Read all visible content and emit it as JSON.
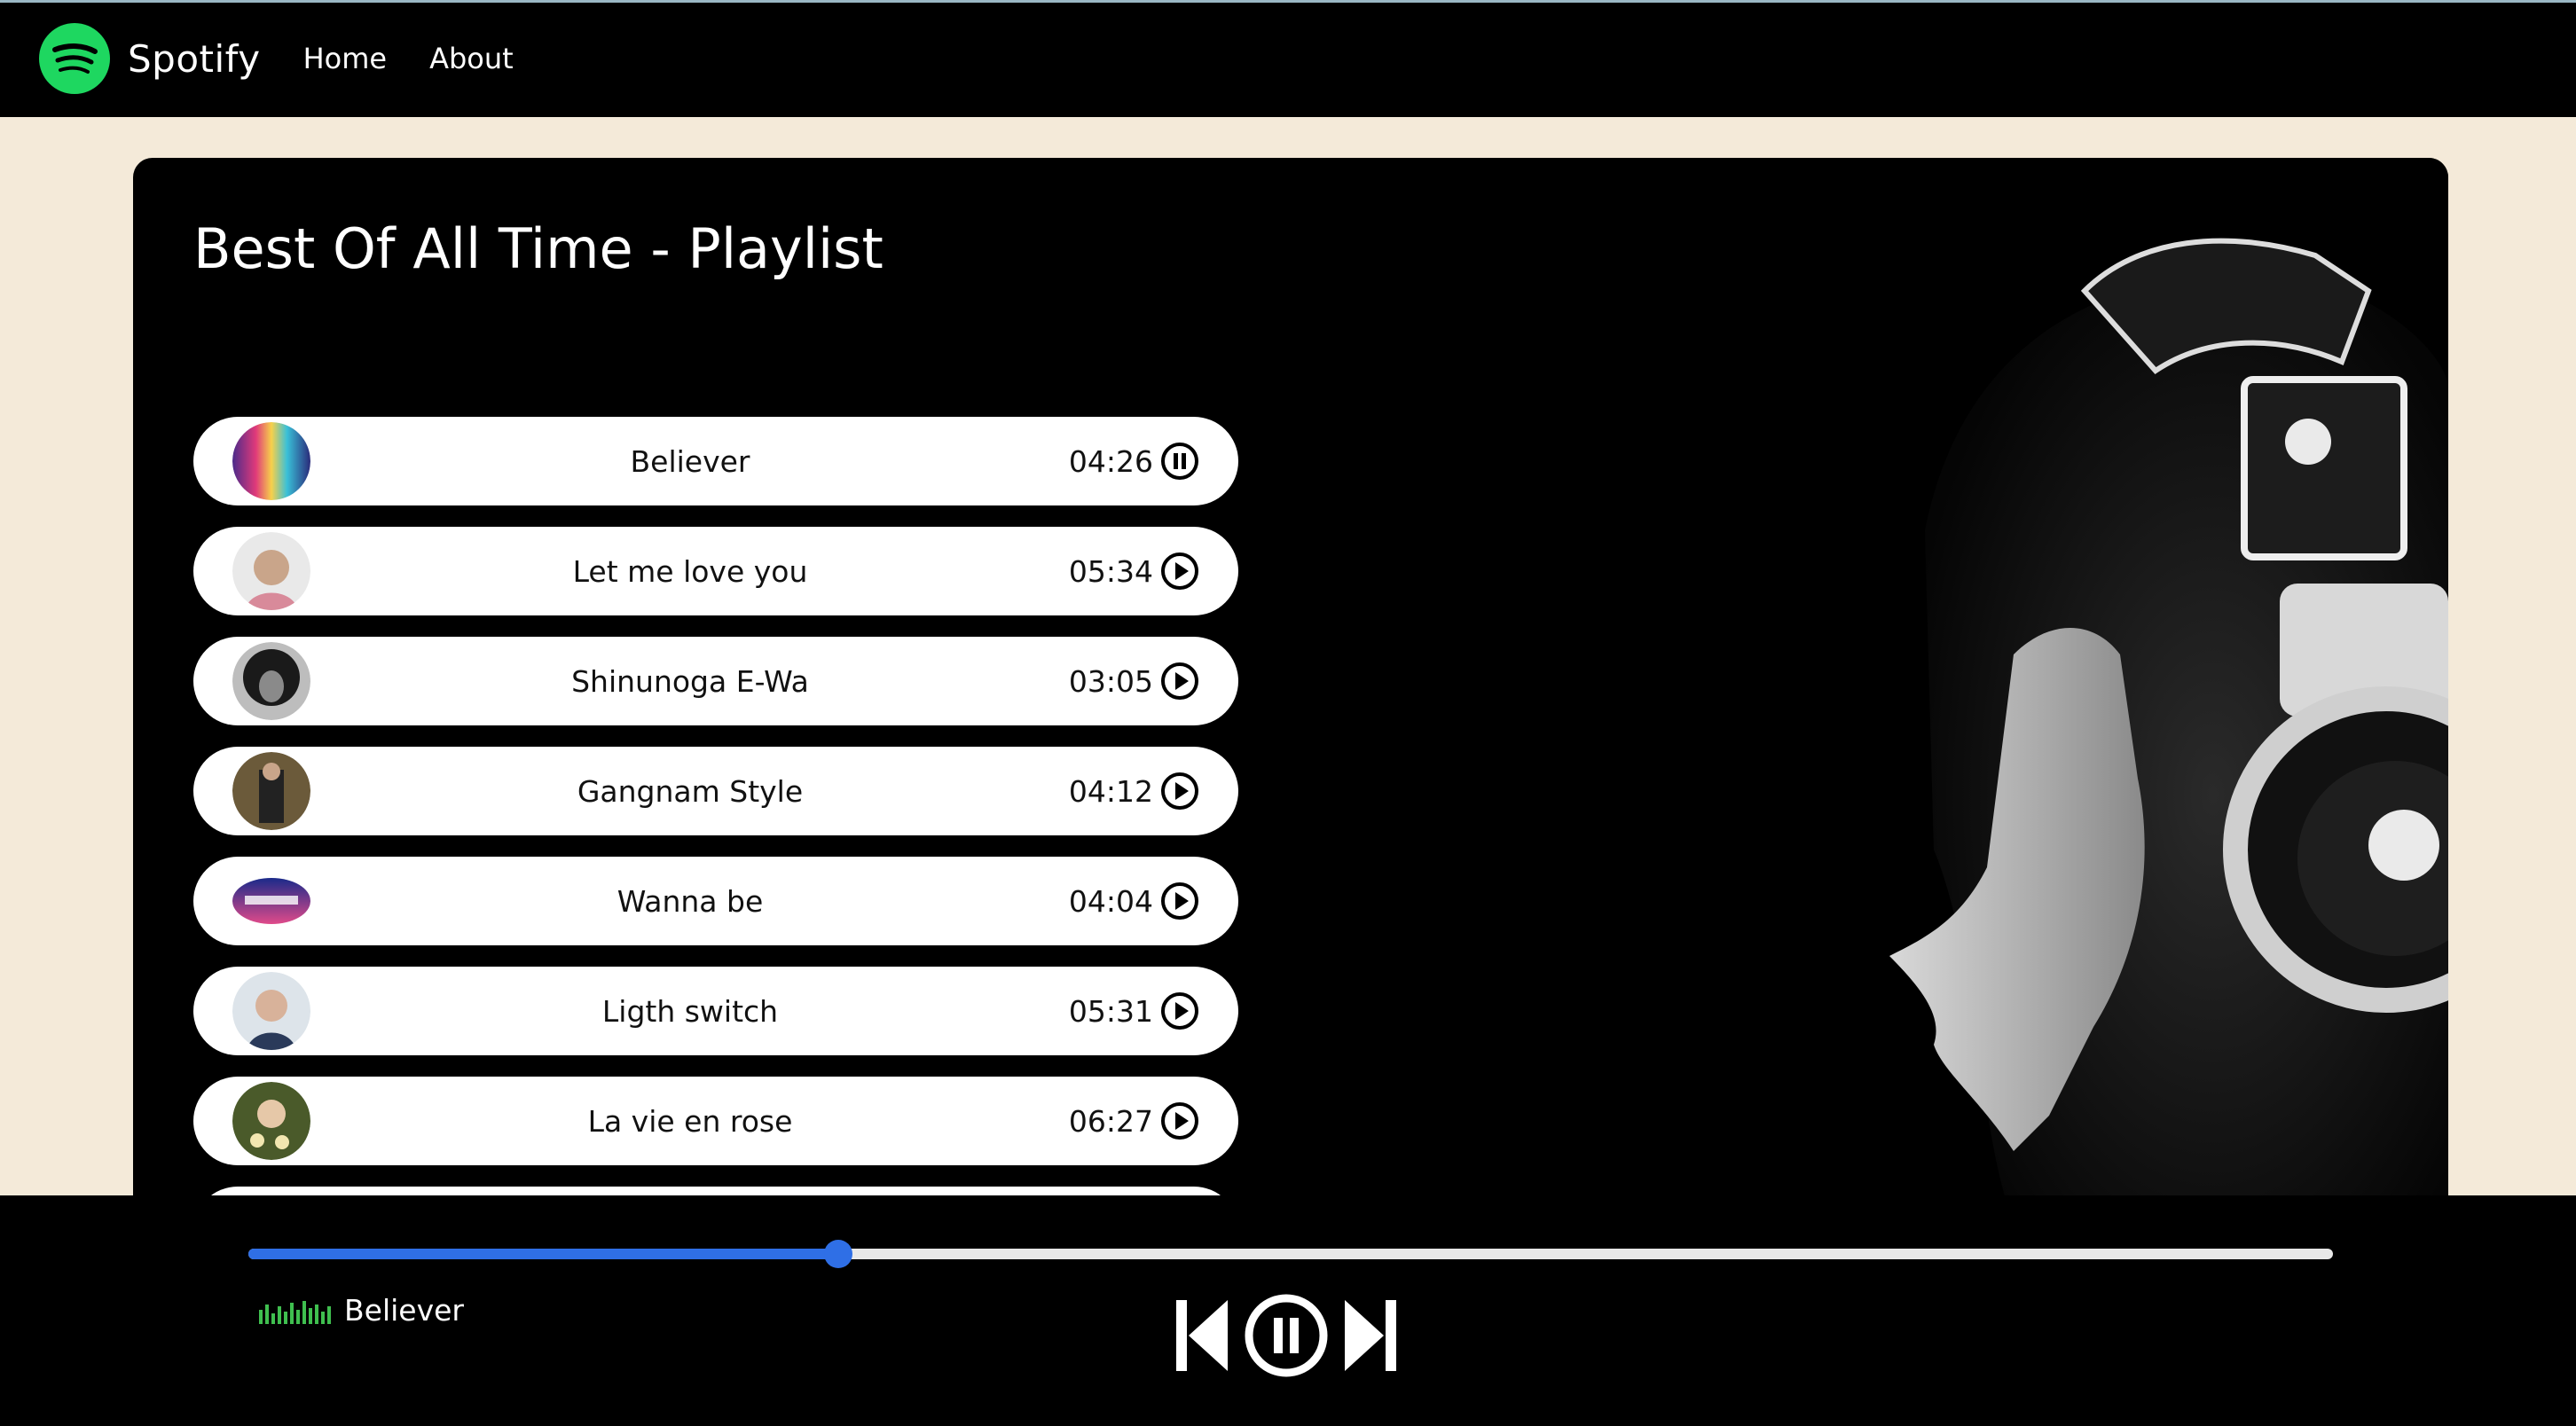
{
  "nav": {
    "brand": "Spotify",
    "links": [
      "Home",
      "About"
    ]
  },
  "playlist": {
    "title": "Best Of All Time - Playlist",
    "songs": [
      {
        "name": "Believer",
        "duration": "04:26",
        "state": "pause-icon"
      },
      {
        "name": "Let me love you",
        "duration": "05:34",
        "state": "play-icon"
      },
      {
        "name": "Shinunoga E-Wa",
        "duration": "03:05",
        "state": "play-icon"
      },
      {
        "name": "Gangnam Style",
        "duration": "04:12",
        "state": "play-icon"
      },
      {
        "name": "Wanna be",
        "duration": "04:04",
        "state": "play-icon"
      },
      {
        "name": "Ligth switch",
        "duration": "05:31",
        "state": "play-icon"
      },
      {
        "name": "La vie en rose",
        "duration": "06:27",
        "state": "play-icon"
      }
    ]
  },
  "player": {
    "now_playing": "Believer",
    "progress_fraction": 0.283,
    "accent": "#2f6fe6",
    "eq_color": "#3fbf4f"
  },
  "colors": {
    "brand_green": "#1ed760",
    "background": "#f4ead9"
  }
}
